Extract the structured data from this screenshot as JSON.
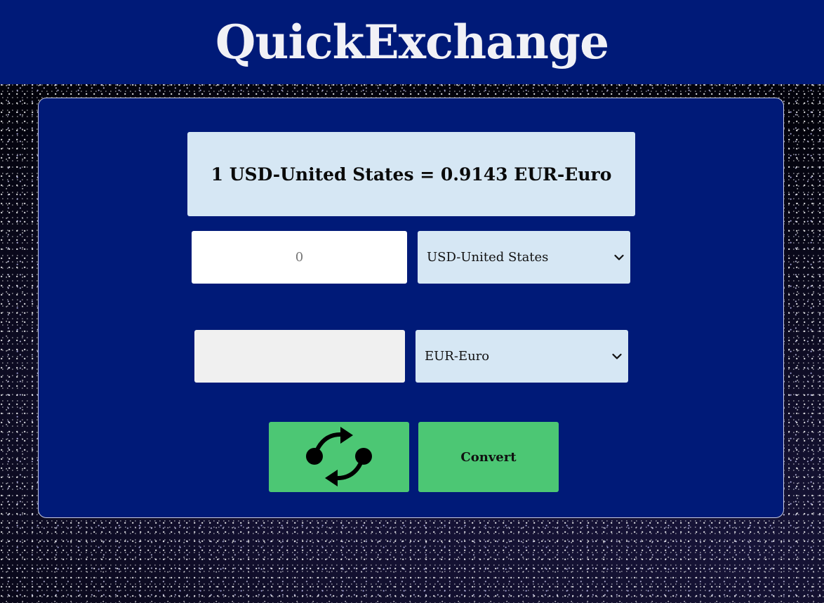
{
  "app": {
    "title": "QuickExchange"
  },
  "rate": {
    "text": "1 USD-United States = 0.9143 EUR-Euro"
  },
  "from": {
    "amount_value": "",
    "amount_placeholder": "0",
    "currency": "USD-United States"
  },
  "to": {
    "amount_value": "",
    "currency": "EUR-Euro"
  },
  "buttons": {
    "swap_icon": "swap-arrows-icon",
    "convert_label": "Convert"
  },
  "colors": {
    "header_bg": "#001a78",
    "card_bg": "#001a78",
    "rate_bg": "#d6e7f4",
    "button_bg": "#4cc774"
  }
}
